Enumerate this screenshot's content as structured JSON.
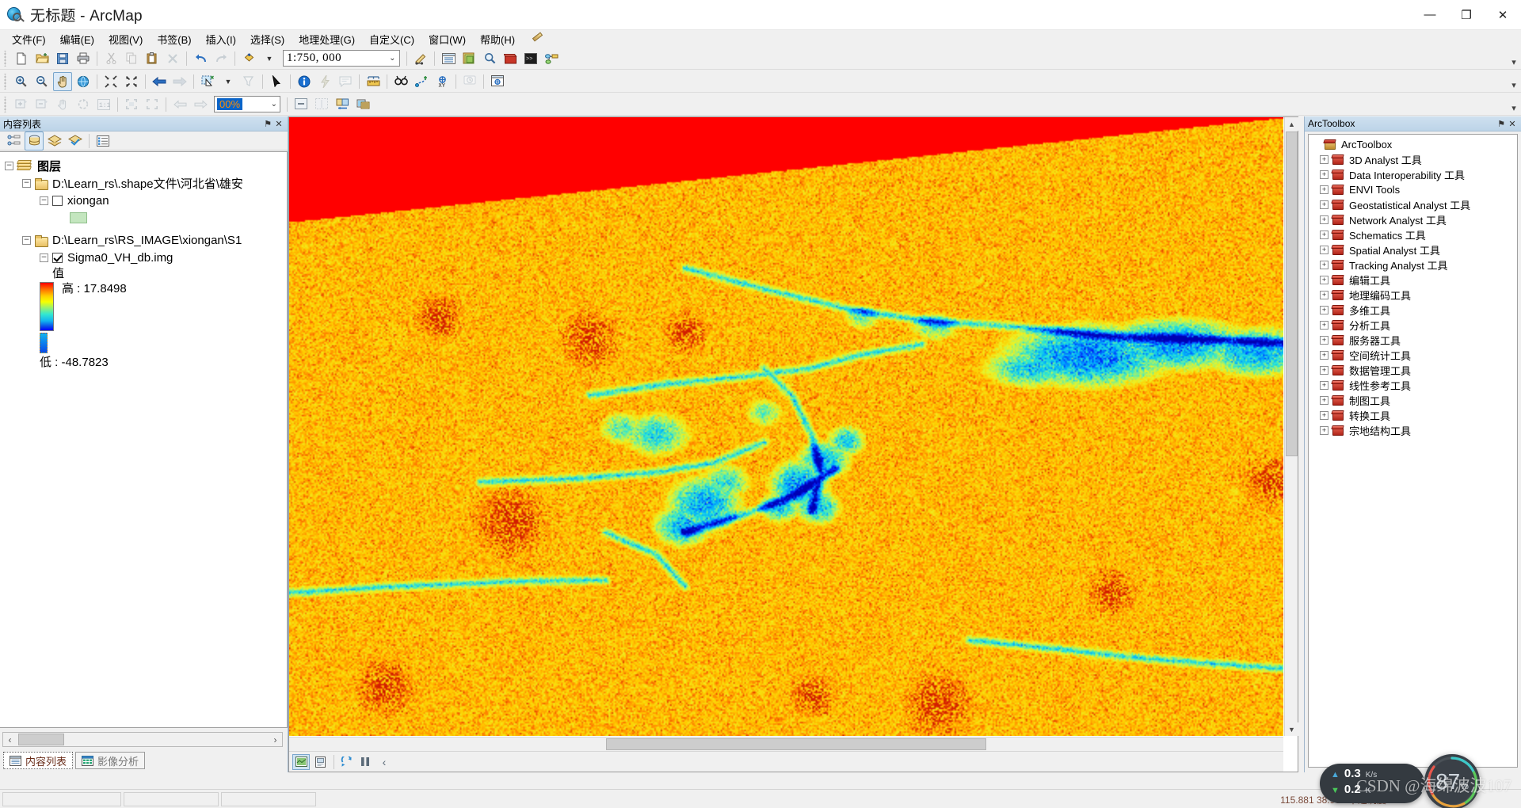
{
  "window": {
    "title": "无标题 - ArcMap",
    "app_icon": "arcmap-globe-icon",
    "minimize": "—",
    "maximize": "❐",
    "close": "✕"
  },
  "menubar": {
    "items": [
      {
        "label": "文件(F)",
        "name": "menu-file"
      },
      {
        "label": "编辑(E)",
        "name": "menu-edit"
      },
      {
        "label": "视图(V)",
        "name": "menu-view"
      },
      {
        "label": "书签(B)",
        "name": "menu-bookmarks"
      },
      {
        "label": "插入(I)",
        "name": "menu-insert"
      },
      {
        "label": "选择(S)",
        "name": "menu-selection"
      },
      {
        "label": "地理处理(G)",
        "name": "menu-geoprocessing"
      },
      {
        "label": "自定义(C)",
        "name": "menu-customize"
      },
      {
        "label": "窗口(W)",
        "name": "menu-window"
      },
      {
        "label": "帮助(H)",
        "name": "menu-help"
      }
    ]
  },
  "standard_toolbar": {
    "scale_value": "1:750, 000",
    "dropdown_glyph": "⌄",
    "buttons": [
      "new-document-icon",
      "open-folder-icon",
      "save-icon",
      "print-icon",
      "cut-icon",
      "copy-icon",
      "paste-icon",
      "delete-icon",
      "undo-icon",
      "redo-icon",
      "add-data-icon",
      "editor-toolbar-icon",
      "table-of-contents-icon",
      "catalog-icon",
      "search-icon",
      "arctoolbox-icon",
      "python-window-icon",
      "modelbuilder-icon"
    ]
  },
  "tools_toolbar": {
    "buttons": [
      "zoom-in-icon",
      "zoom-out-icon",
      "pan-icon",
      "full-extent-icon",
      "fixed-zoom-in-icon",
      "fixed-zoom-out-icon",
      "go-back-extent-icon",
      "go-forward-extent-icon",
      "select-features-icon",
      "clear-selection-icon",
      "select-elements-icon",
      "identify-icon",
      "hyperlink-icon",
      "html-popup-icon",
      "measure-icon",
      "find-icon",
      "find-route-icon",
      "go-to-xy-icon",
      "time-slider-icon",
      "create-viewer-window-icon"
    ],
    "active": "pan-icon"
  },
  "image_toolbar": {
    "zoom_percent": "00%",
    "dropdown_glyph": "⌄",
    "buttons": [
      "raster-zoom-in-icon",
      "raster-zoom-out-icon",
      "raster-pan-icon",
      "raster-rotate-icon",
      "one-to-one-icon",
      "fit-to-display-icon",
      "actual-size-icon",
      "previous-image-icon",
      "next-image-icon",
      "hide-image-icon",
      "flicker-icon",
      "swipe-icon",
      "image-analysis-icon"
    ],
    "overflow_glyph": "▾"
  },
  "toc": {
    "title": "内容列表",
    "pin_glyph": "⚑",
    "close_glyph": "✕",
    "toolbar_buttons": [
      "list-by-drawing-order-icon",
      "list-by-source-icon",
      "list-by-visibility-icon",
      "list-by-selection-icon",
      "options-icon"
    ],
    "active_toolbar_button": "list-by-source-icon",
    "tree": {
      "root": "图层",
      "groups": [
        {
          "path": "D:\\Learn_rs\\.shape文件\\河北省\\雄安",
          "layer": "xiongan",
          "checked": false,
          "symbol_type": "polygon-swatch",
          "symbol_color": "#c4e6bf"
        },
        {
          "path": "D:\\Learn_rs\\RS_IMAGE\\xiongan\\S1",
          "layer": "Sigma0_VH_db.img",
          "checked": true,
          "value_label": "值",
          "high_label": "高 : 17.8498",
          "low_label": "低 : -48.7823"
        }
      ]
    },
    "scroll": {
      "left_glyph": "‹",
      "right_glyph": "›"
    },
    "tabs": [
      {
        "label": "内容列表",
        "icon": "toc-tab-icon",
        "selected": true
      },
      {
        "label": "影像分析",
        "icon": "image-analysis-tab-icon",
        "selected": false
      }
    ]
  },
  "map": {
    "vscroll": {
      "up_glyph": "▲",
      "down_glyph": "▼"
    },
    "hscroll": {
      "left_glyph": "◀",
      "right_glyph": "▶"
    },
    "bottom_buttons": [
      "data-view-icon",
      "layout-view-icon",
      "refresh-icon",
      "pause-drawing-icon",
      "collapse-icon"
    ],
    "active_bottom_button": "data-view-icon",
    "raster_colors": {
      "high": "#ff0000",
      "mid_high": "#ffd000",
      "mid": "#f6ff00",
      "mid_low": "#33e8d0",
      "low": "#0000ff",
      "nodata_band": "#ff0000"
    }
  },
  "arctoolbox": {
    "title": "ArcToolbox",
    "pin_glyph": "⚑",
    "close_glyph": "✕",
    "root": "ArcToolbox",
    "items": [
      "3D Analyst 工具",
      "Data Interoperability 工具",
      "ENVI Tools",
      "Geostatistical Analyst 工具",
      "Network Analyst 工具",
      "Schematics 工具",
      "Spatial Analyst 工具",
      "Tracking Analyst 工具",
      "编辑工具",
      "地理编码工具",
      "多维工具",
      "分析工具",
      "服务器工具",
      "空间统计工具",
      "数据管理工具",
      "线性参考工具",
      "制图工具",
      "转换工具",
      "宗地结构工具"
    ],
    "expand_glyph": "+"
  },
  "statusbar": {
    "coordinates": "115.881  38.935  十进制度"
  },
  "net_widget": {
    "upload_arrow": "▲",
    "upload_value": "0.3",
    "upload_unit": "K/s",
    "download_arrow": "▼",
    "download_value": "0.2",
    "download_unit": "K",
    "gauge_value": "87",
    "gauge_unit": "%",
    "gauge_colors": [
      "#e8574c",
      "#e8a23c",
      "#5ac85a",
      "#3ec8c8"
    ]
  },
  "watermark": {
    "text": "CSDN @海绵波波107"
  }
}
